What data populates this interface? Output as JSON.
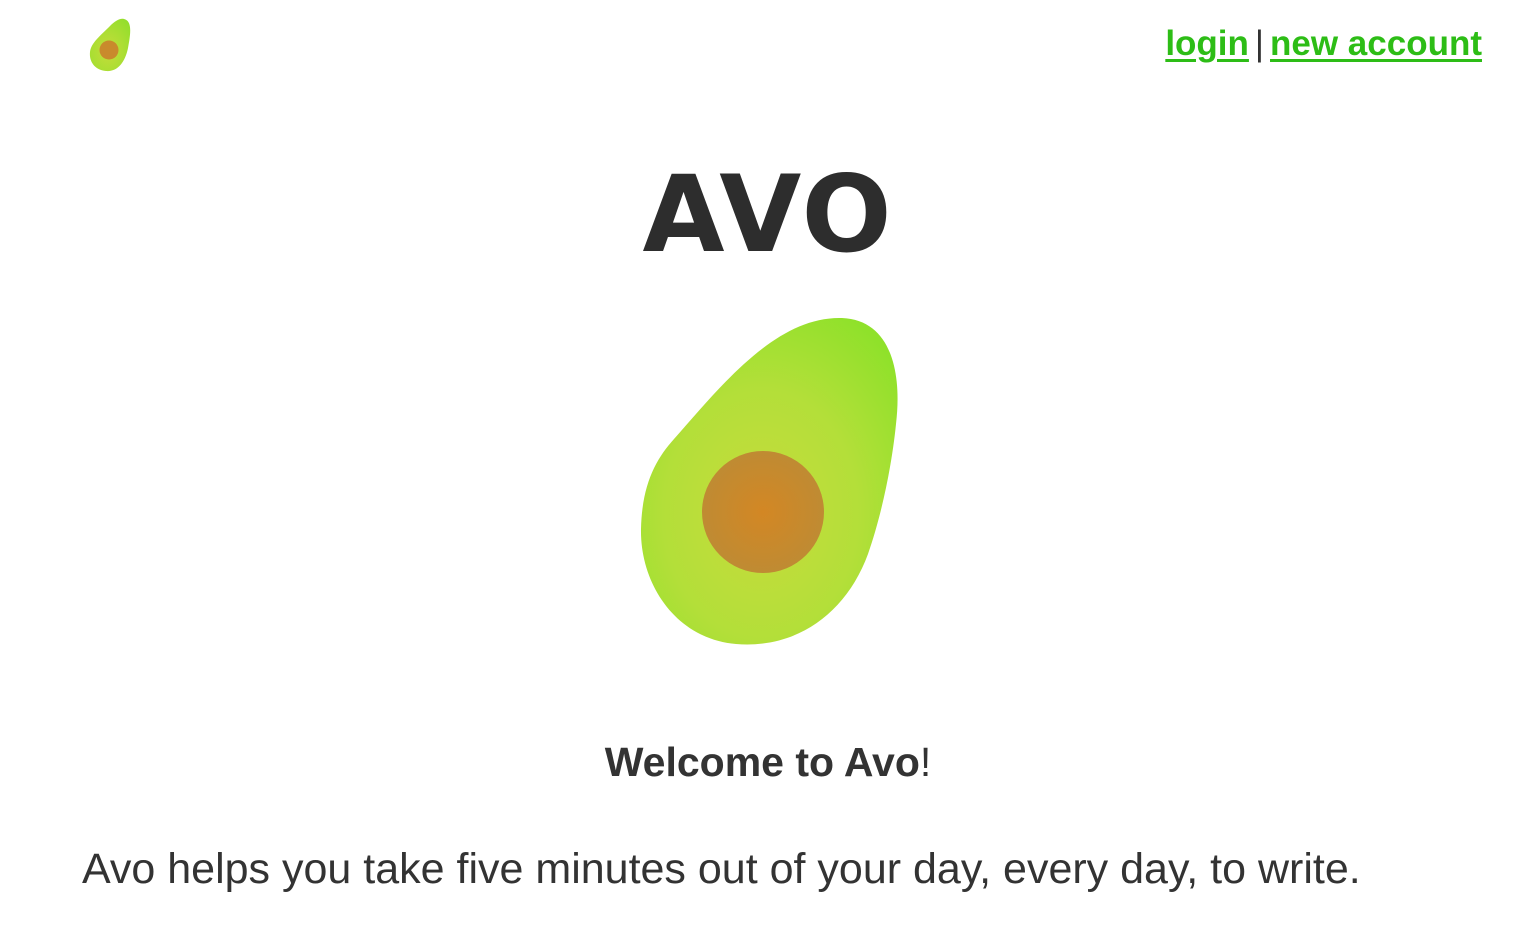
{
  "header": {
    "logo_icon": "avocado-icon",
    "login_label": "login",
    "separator": "|",
    "new_account_label": "new account"
  },
  "hero": {
    "title": "AVO",
    "logo_icon": "avocado-icon"
  },
  "welcome": {
    "text": "Welcome to Avo",
    "punctuation": "!"
  },
  "tagline": "Avo helps you take five minutes out of your day, every day, to write.",
  "colors": {
    "link": "#2dbd16",
    "text": "#333333",
    "avocado_flesh": "#9de12b",
    "avocado_pit": "#c98a2c"
  }
}
